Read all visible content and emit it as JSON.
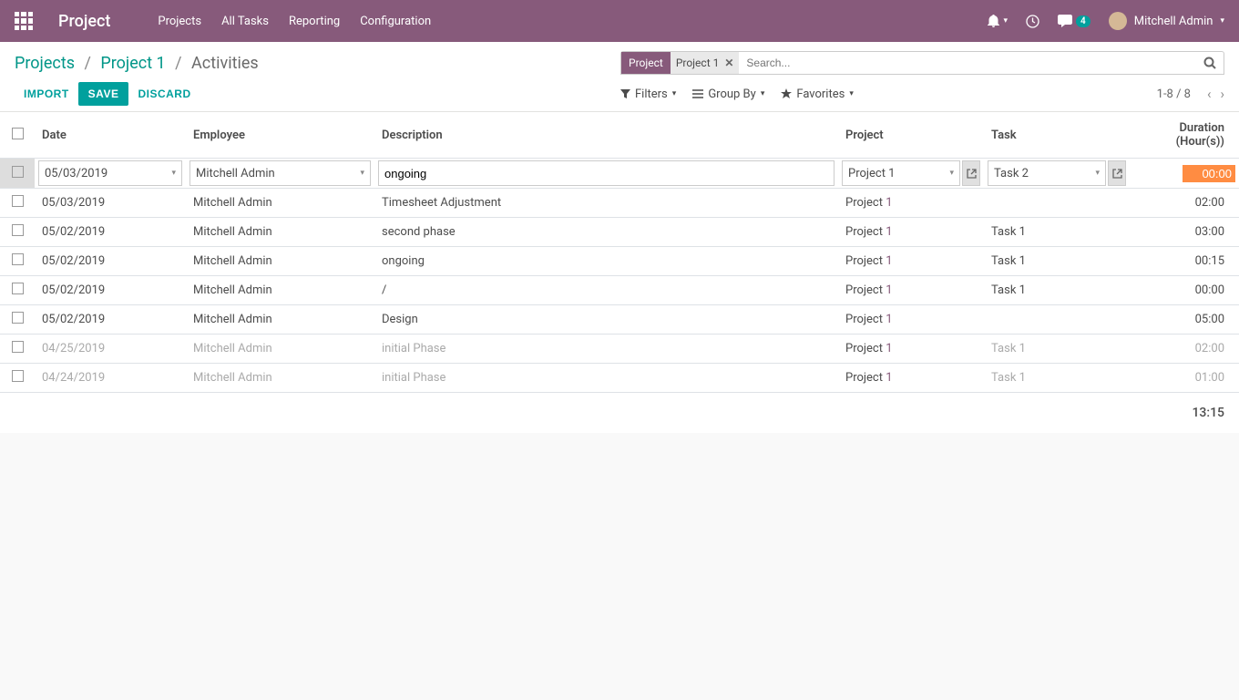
{
  "topbar": {
    "app_title": "Project",
    "nav": [
      "Projects",
      "All Tasks",
      "Reporting",
      "Configuration"
    ],
    "msg_count": "4",
    "user_name": "Mitchell Admin"
  },
  "breadcrumb": {
    "seg1": "Projects",
    "seg2": "Project 1",
    "seg3": "Activities"
  },
  "search": {
    "facet_label": "Project",
    "facet_value": "Project 1",
    "placeholder": "Search..."
  },
  "actions": {
    "import": "IMPORT",
    "save": "SAVE",
    "discard": "DISCARD"
  },
  "search_opts": {
    "filters": "Filters",
    "groupby": "Group By",
    "favorites": "Favorites"
  },
  "pager": "1-8 / 8",
  "columns": {
    "date": "Date",
    "employee": "Employee",
    "description": "Description",
    "project": "Project",
    "task": "Task",
    "duration": "Duration (Hour(s))"
  },
  "edit_row": {
    "date": "05/03/2019",
    "employee": "Mitchell Admin",
    "description": "ongoing",
    "project": "Project 1",
    "task": "Task 2",
    "duration": "00:00"
  },
  "rows": [
    {
      "date": "05/03/2019",
      "employee": "Mitchell Admin",
      "description": "Timesheet Adjustment",
      "project": "Project",
      "pnum": "1",
      "task": "",
      "duration": "02:00",
      "muted": false
    },
    {
      "date": "05/02/2019",
      "employee": "Mitchell Admin",
      "description": "second phase",
      "project": "Project",
      "pnum": "1",
      "task": "Task 1",
      "duration": "03:00",
      "muted": false
    },
    {
      "date": "05/02/2019",
      "employee": "Mitchell Admin",
      "description": "ongoing",
      "project": "Project",
      "pnum": "1",
      "task": "Task 1",
      "duration": "00:15",
      "muted": false
    },
    {
      "date": "05/02/2019",
      "employee": "Mitchell Admin",
      "description": "/",
      "project": "Project",
      "pnum": "1",
      "task": "Task 1",
      "duration": "00:00",
      "muted": false
    },
    {
      "date": "05/02/2019",
      "employee": "Mitchell Admin",
      "description": "Design",
      "project": "Project",
      "pnum": "1",
      "task": "",
      "duration": "05:00",
      "muted": false
    },
    {
      "date": "04/25/2019",
      "employee": "Mitchell Admin",
      "description": "initial Phase",
      "project": "Project",
      "pnum": "1",
      "task": "Task 1",
      "duration": "02:00",
      "muted": true
    },
    {
      "date": "04/24/2019",
      "employee": "Mitchell Admin",
      "description": "initial Phase",
      "project": "Project",
      "pnum": "1",
      "task": "Task 1",
      "duration": "01:00",
      "muted": true
    }
  ],
  "total": "13:15"
}
